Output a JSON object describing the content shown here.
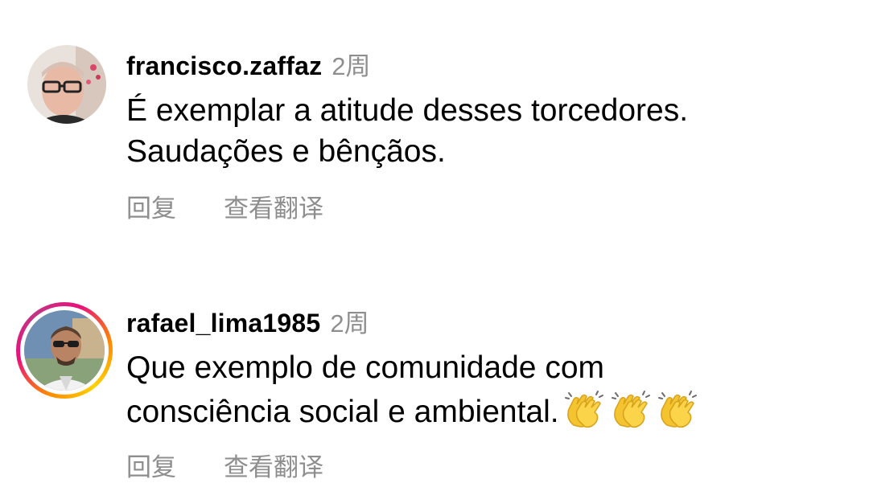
{
  "comments": [
    {
      "username": "francisco.zaffaz",
      "time": "2周",
      "text_lines": [
        "É exemplar a atitude desses torcedores.",
        "Saudações e bênçãos."
      ],
      "reply_label": "回复",
      "translate_label": "查看翻译",
      "has_story_ring": false
    },
    {
      "username": "rafael_lima1985",
      "time": "2周",
      "text_lines": [
        "Que exemplo de comunidade com",
        "consciência social e ambiental."
      ],
      "emoji": "👏👏👏",
      "reply_label": "回复",
      "translate_label": "查看翻译",
      "has_story_ring": true
    }
  ],
  "colors": {
    "text": "#000000",
    "secondary": "#8e8e8e",
    "ring_gradient": [
      "#ffd200",
      "#ff8a00",
      "#e8127a",
      "#c13584"
    ]
  }
}
